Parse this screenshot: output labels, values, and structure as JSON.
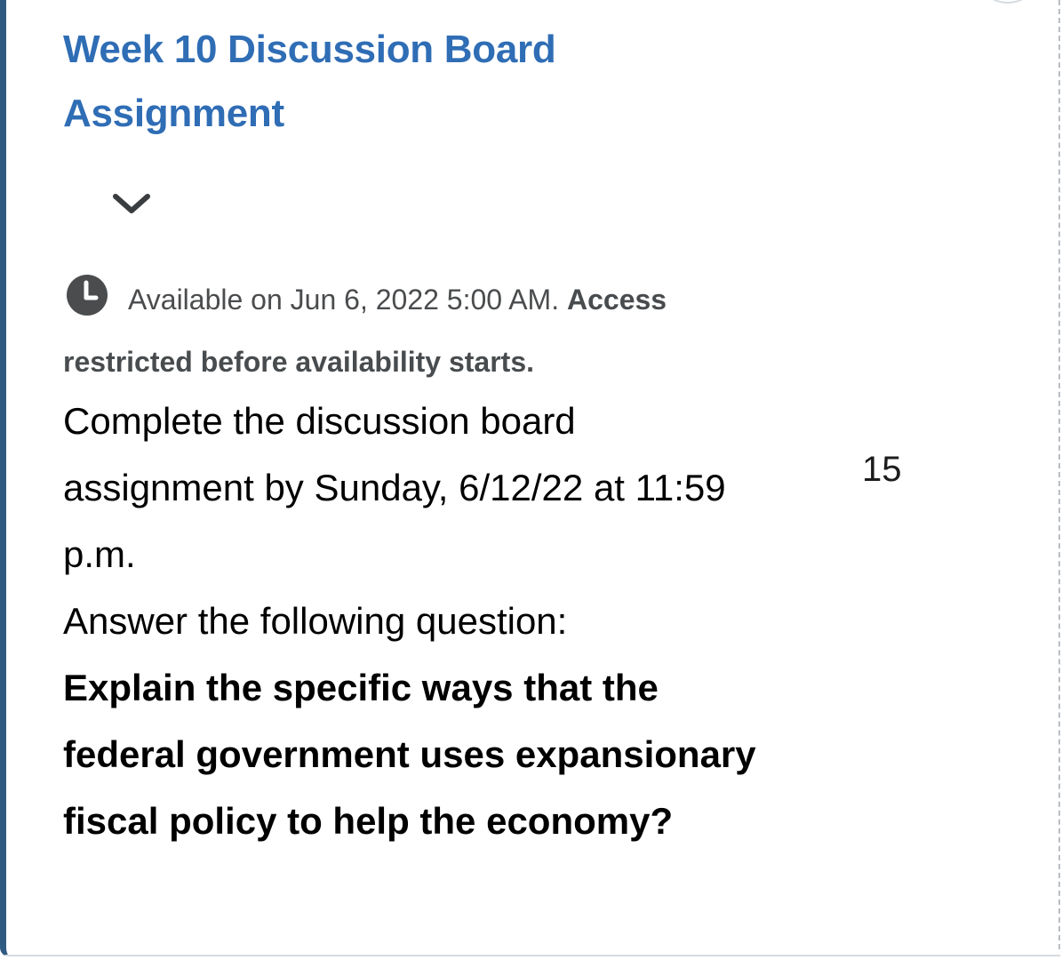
{
  "assignment": {
    "title": "Week 10 Discussion Board Assignment",
    "availability_text": "Available on Jun 6, 2022 5:00 AM.",
    "availability_strong": "Access restricted before availability starts.",
    "description_line1": "Complete the discussion board assignment by Sunday, 6/12/22 at 11:59 p.m.",
    "description_line2": "Answer the following question:",
    "question": "Explain the specific ways that the federal government uses expansionary fiscal policy to help the economy?",
    "points": "15"
  },
  "icons": {
    "expand": "chevron-down-icon",
    "availability": "clock-icon"
  },
  "colors": {
    "title": "#2f6db5",
    "accent_bar": "#2f5b82",
    "meta_text": "#4a4c4e"
  }
}
